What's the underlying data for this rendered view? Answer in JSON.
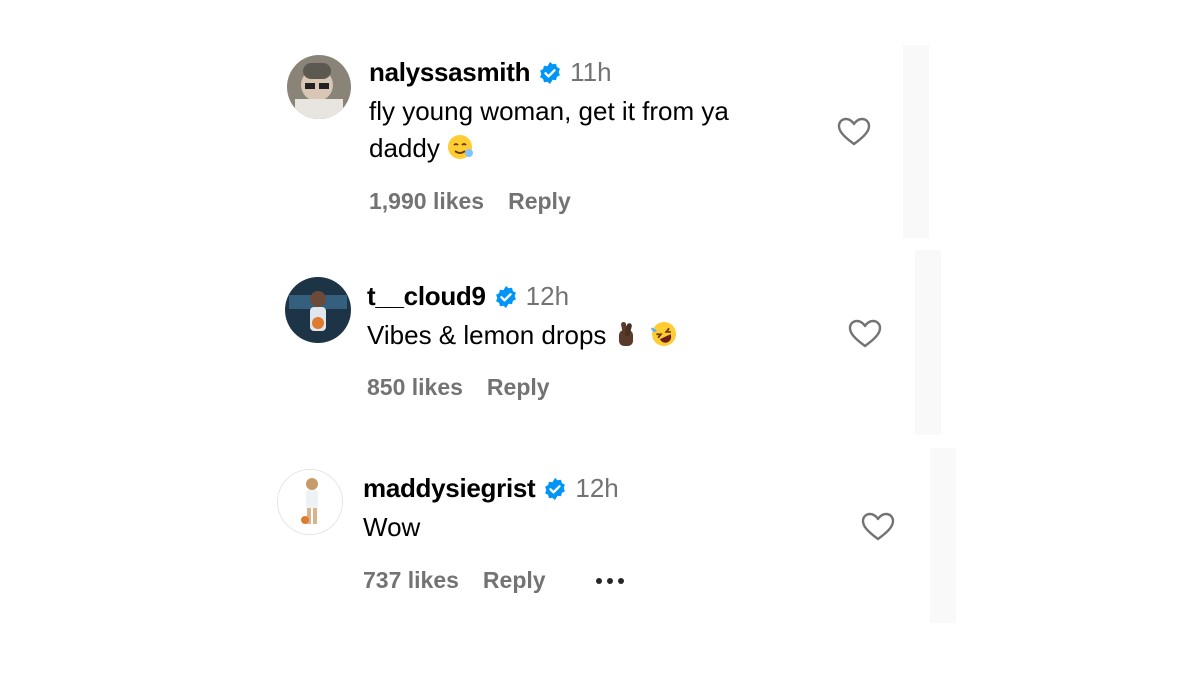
{
  "comments": [
    {
      "username": "nalyssasmith",
      "time": "11h",
      "text_line1": "fly young woman, get it from ya",
      "text_line2": "daddy",
      "emoji": "smiling-face-with-hearts-emoji",
      "likes": "1,990 likes",
      "reply": "Reply"
    },
    {
      "username": "t__cloud9",
      "time": "12h",
      "text_line1": "Vibes & lemon drops",
      "emoji": "crossed-fingers-and-rofl-emoji",
      "likes": "850 likes",
      "reply": "Reply"
    },
    {
      "username": "maddysiegrist",
      "time": "12h",
      "text_line1": "Wow",
      "likes": "737 likes",
      "reply": "Reply",
      "more": "more-options-icon"
    }
  ],
  "colors": {
    "verified": "#0095f6",
    "secondary_text": "#737373",
    "primary_text": "#000000"
  }
}
